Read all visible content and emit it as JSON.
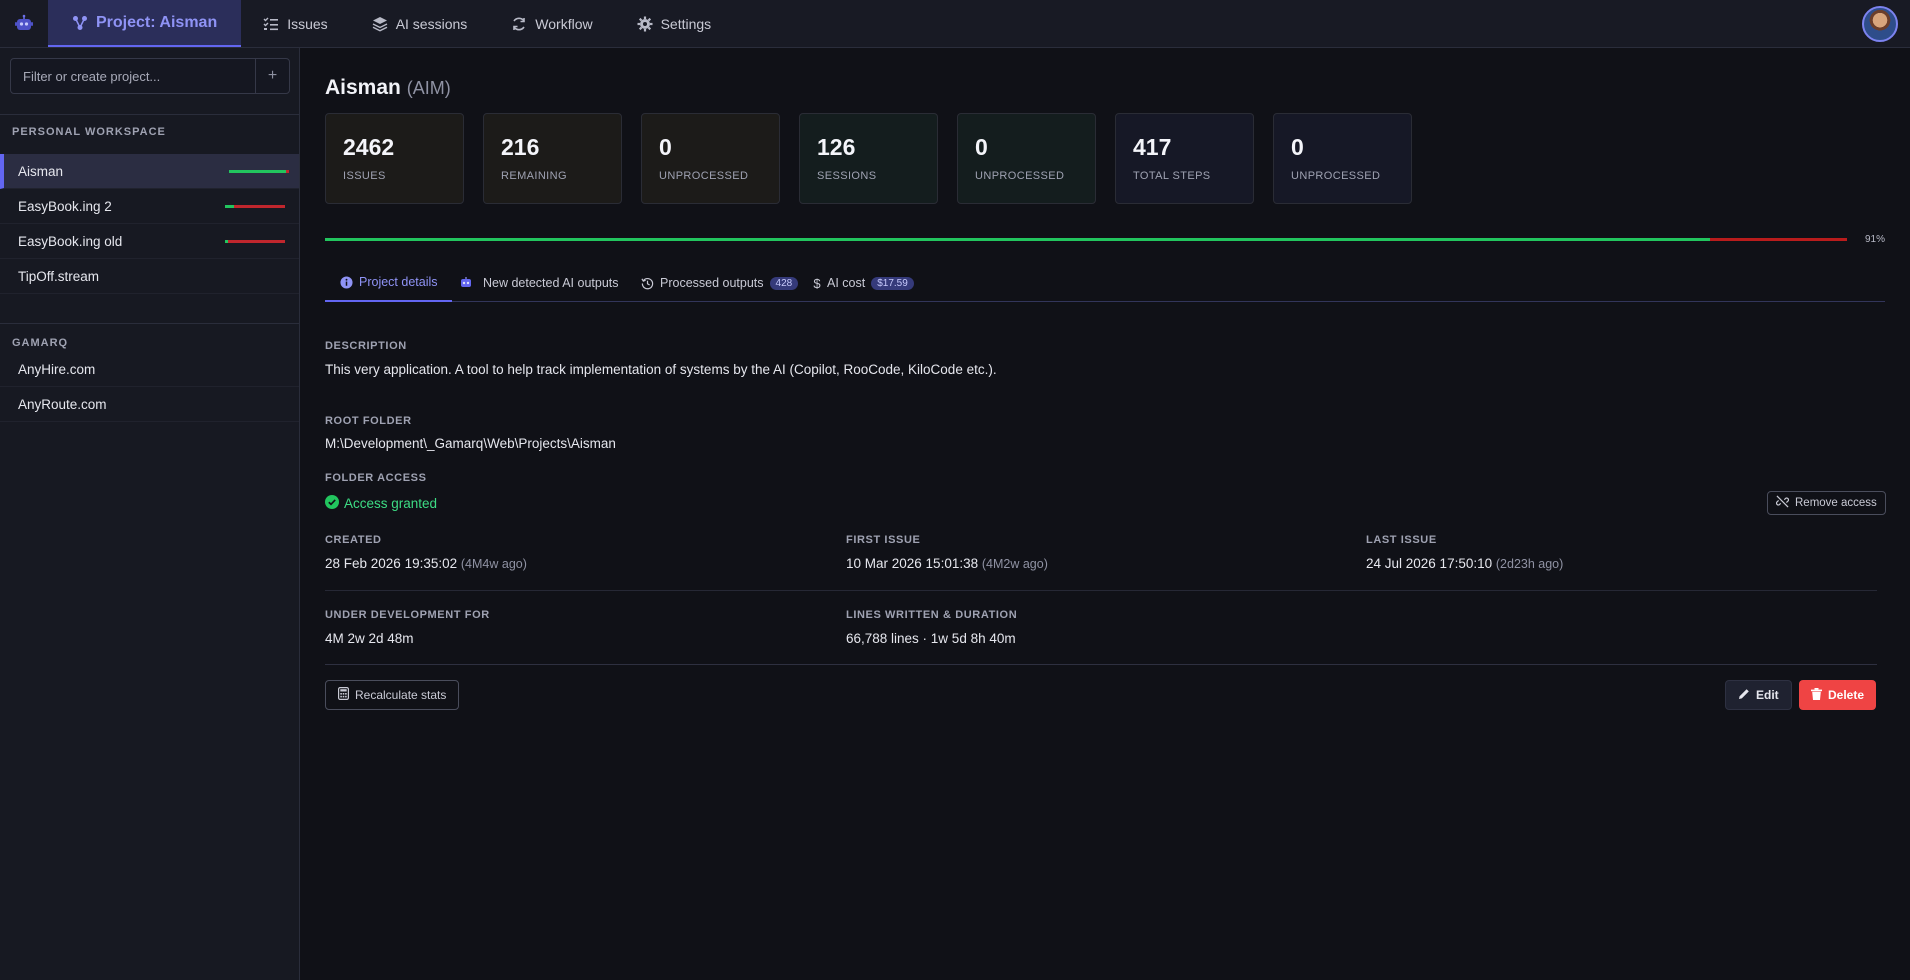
{
  "nav": {
    "project_tab": "Project: Aisman",
    "issues": "Issues",
    "ai_sessions": "AI sessions",
    "workflow": "Workflow",
    "settings": "Settings"
  },
  "sidebar": {
    "filter_placeholder": "Filter or create project...",
    "add_label": "+",
    "sections": [
      {
        "title": "PERSONAL WORKSPACE",
        "items": [
          {
            "label": "Aisman",
            "progress": 0.95
          },
          {
            "label": "EasyBook.ing 2",
            "progress": 0.15
          },
          {
            "label": "EasyBook.ing old",
            "progress": 0.05
          },
          {
            "label": "TipOff.stream"
          }
        ]
      },
      {
        "title": "GAMARQ",
        "items": [
          {
            "label": "AnyHire.com"
          },
          {
            "label": "AnyRoute.com"
          }
        ]
      }
    ]
  },
  "project": {
    "name": "Aisman",
    "code": "(AIM)",
    "stats": [
      {
        "value": "2462",
        "label": "ISSUES"
      },
      {
        "value": "216",
        "label": "REMAINING"
      },
      {
        "value": "0",
        "label": "UNPROCESSED"
      },
      {
        "value": "126",
        "label": "SESSIONS"
      },
      {
        "value": "0",
        "label": "UNPROCESSED"
      },
      {
        "value": "417",
        "label": "TOTAL STEPS"
      },
      {
        "value": "0",
        "label": "UNPROCESSED"
      }
    ],
    "progress_value": 0.91,
    "progress_text": "91%"
  },
  "tabs": [
    {
      "label": "Project details"
    },
    {
      "label": "New detected AI outputs"
    },
    {
      "label": "Processed outputs",
      "badge": "428"
    },
    {
      "label": "AI cost",
      "badge": "$17.59"
    }
  ],
  "details": {
    "description_label": "DESCRIPTION",
    "description": "This very application. A tool to help track implementation of systems by the AI (Copilot, RooCode, KiloCode etc.).",
    "root_folder_label": "ROOT FOLDER",
    "root_folder": "M:\\Development\\_Gamarq\\Web\\Projects\\Aisman",
    "folder_access_label": "FOLDER ACCESS",
    "folder_access": "Access granted",
    "remove_access": "Remove access",
    "created_label": "CREATED",
    "created": "28 Feb 2026 19:35:02",
    "created_ago": "(4M4w ago)",
    "first_issue_label": "FIRST ISSUE",
    "first_issue": "10 Mar 2026 15:01:38",
    "first_issue_ago": "(4M2w ago)",
    "last_issue_label": "LAST ISSUE",
    "last_issue": "24 Jul 2026 17:50:10",
    "last_issue_ago": "(2d23h ago)",
    "under_dev_label": "UNDER DEVELOPMENT FOR",
    "under_dev": "4M 2w 2d 48m",
    "lines_label": "LINES WRITTEN & DURATION",
    "lines": "66,788 lines · 1w 5d 8h 40m"
  },
  "actions": {
    "recalculate": "Recalculate stats",
    "edit": "Edit",
    "delete": "Delete"
  },
  "colors": {
    "accent": "#6366f1",
    "success": "#22c55e",
    "danger": "#ef4444"
  }
}
